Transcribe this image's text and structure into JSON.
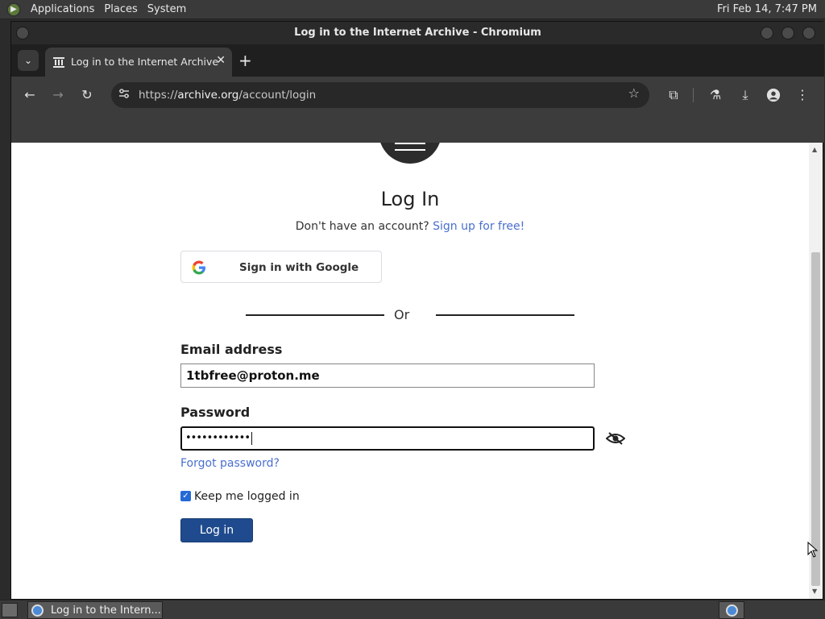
{
  "desktop": {
    "menus": [
      "Applications",
      "Places",
      "System"
    ],
    "clock": "Fri Feb 14,  7:47 PM"
  },
  "window": {
    "title": "Log in to the Internet Archive - Chromium"
  },
  "browser": {
    "tab_title": "Log in to the Internet Archive",
    "url_prefix": "https://",
    "url_host": "archive.org",
    "url_path": "/account/login"
  },
  "page": {
    "heading": "Log In",
    "no_account": "Don't have an account?",
    "signup_link": "Sign up for free!",
    "google_button": "Sign in with Google",
    "or": "Or",
    "email_label": "Email address",
    "email_value": "1tbfree@proton.me",
    "password_label": "Password",
    "password_value": "••••••••••••",
    "forgot_link": "Forgot password?",
    "keep_logged_in": "Keep me logged in",
    "login_button": "Log in"
  },
  "taskbar": {
    "item_label": "Log in to the Intern..."
  },
  "colors": {
    "link": "#4a6fcf",
    "login_button": "#1f4b8e",
    "checkbox": "#2469d6"
  }
}
